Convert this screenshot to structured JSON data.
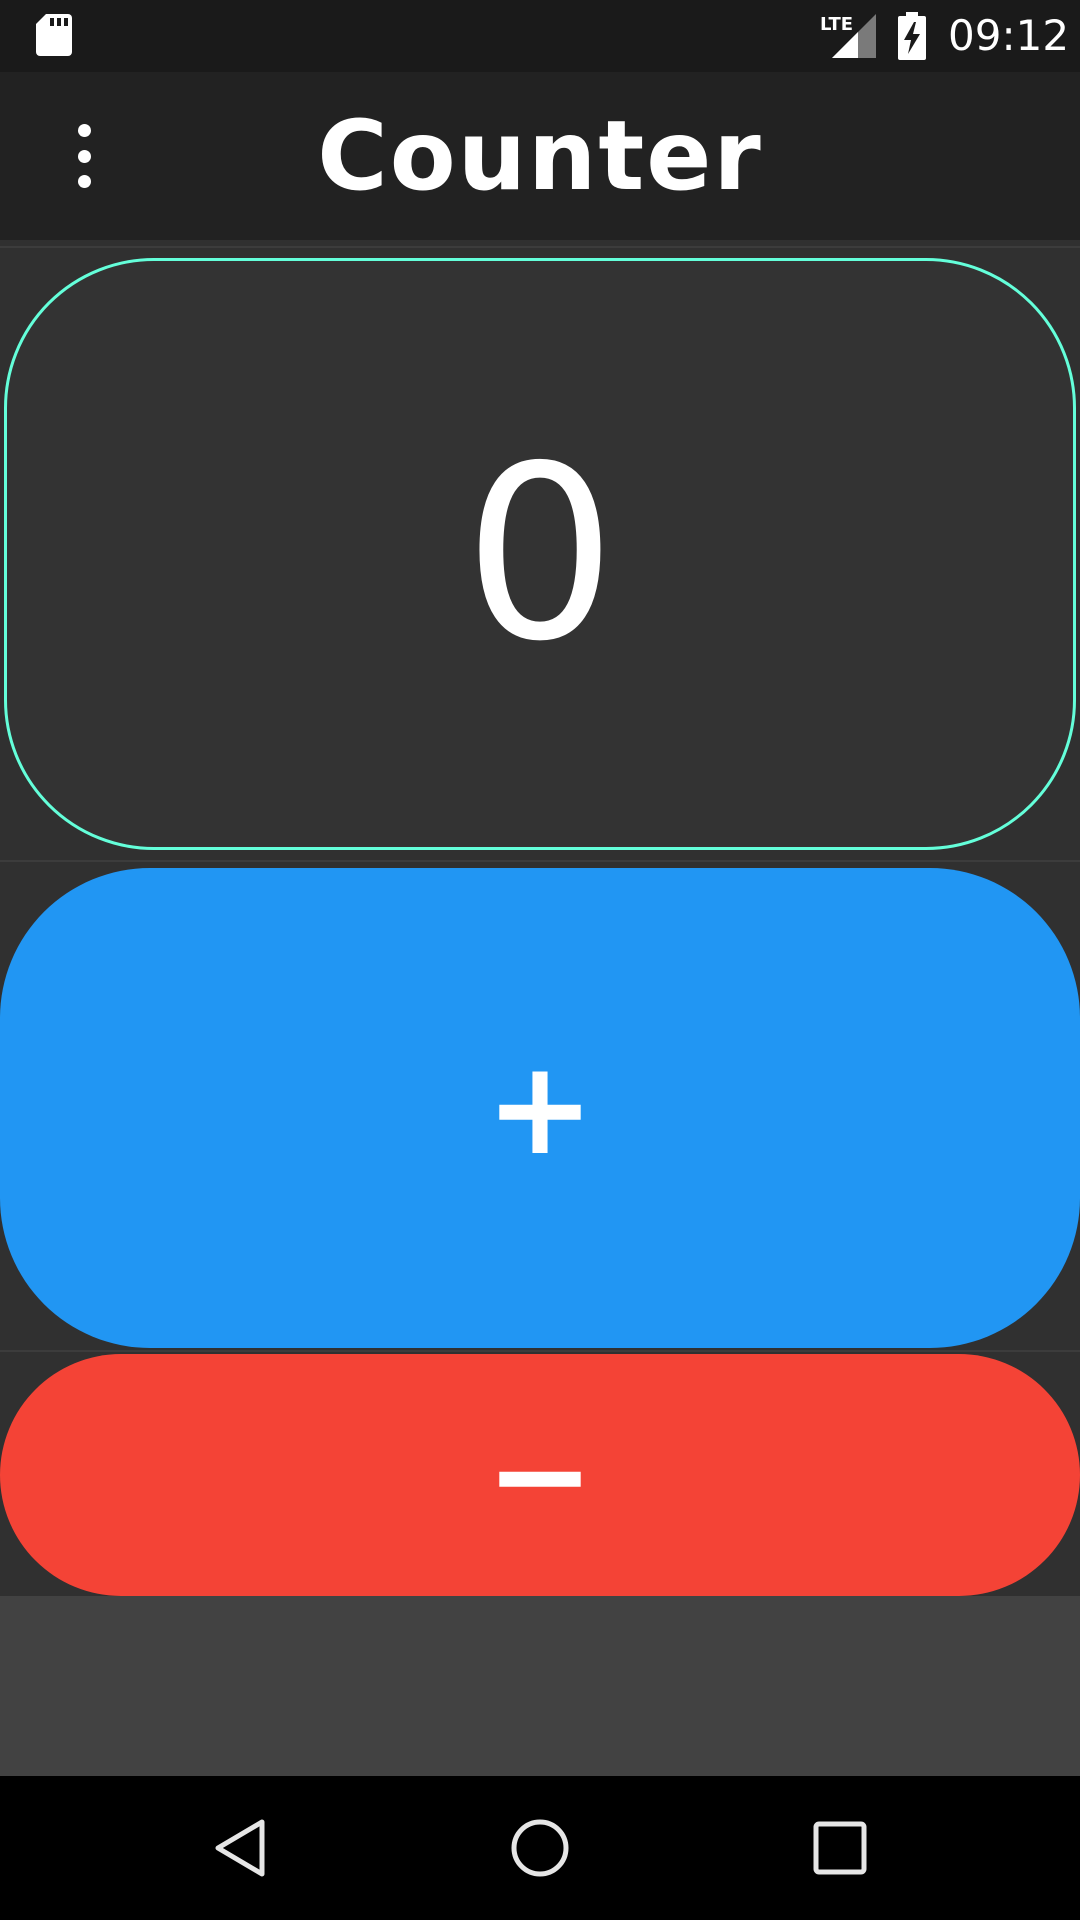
{
  "status_bar": {
    "time": "09:12",
    "network_label": "LTE",
    "icons": [
      "sd-card-icon",
      "lte-signal-icon",
      "battery-charging-icon"
    ]
  },
  "app_bar": {
    "title": "Counter",
    "menu_icon": "overflow-menu-icon"
  },
  "counter": {
    "value": "0"
  },
  "buttons": {
    "increment_label": "+",
    "decrement_label": "−"
  },
  "nav_bar": {
    "icons": [
      "back-icon",
      "home-icon",
      "recents-icon"
    ]
  },
  "colors": {
    "card_border": "#64ffda",
    "increment": "#2196f3",
    "decrement": "#f44336",
    "background": "#303030"
  }
}
